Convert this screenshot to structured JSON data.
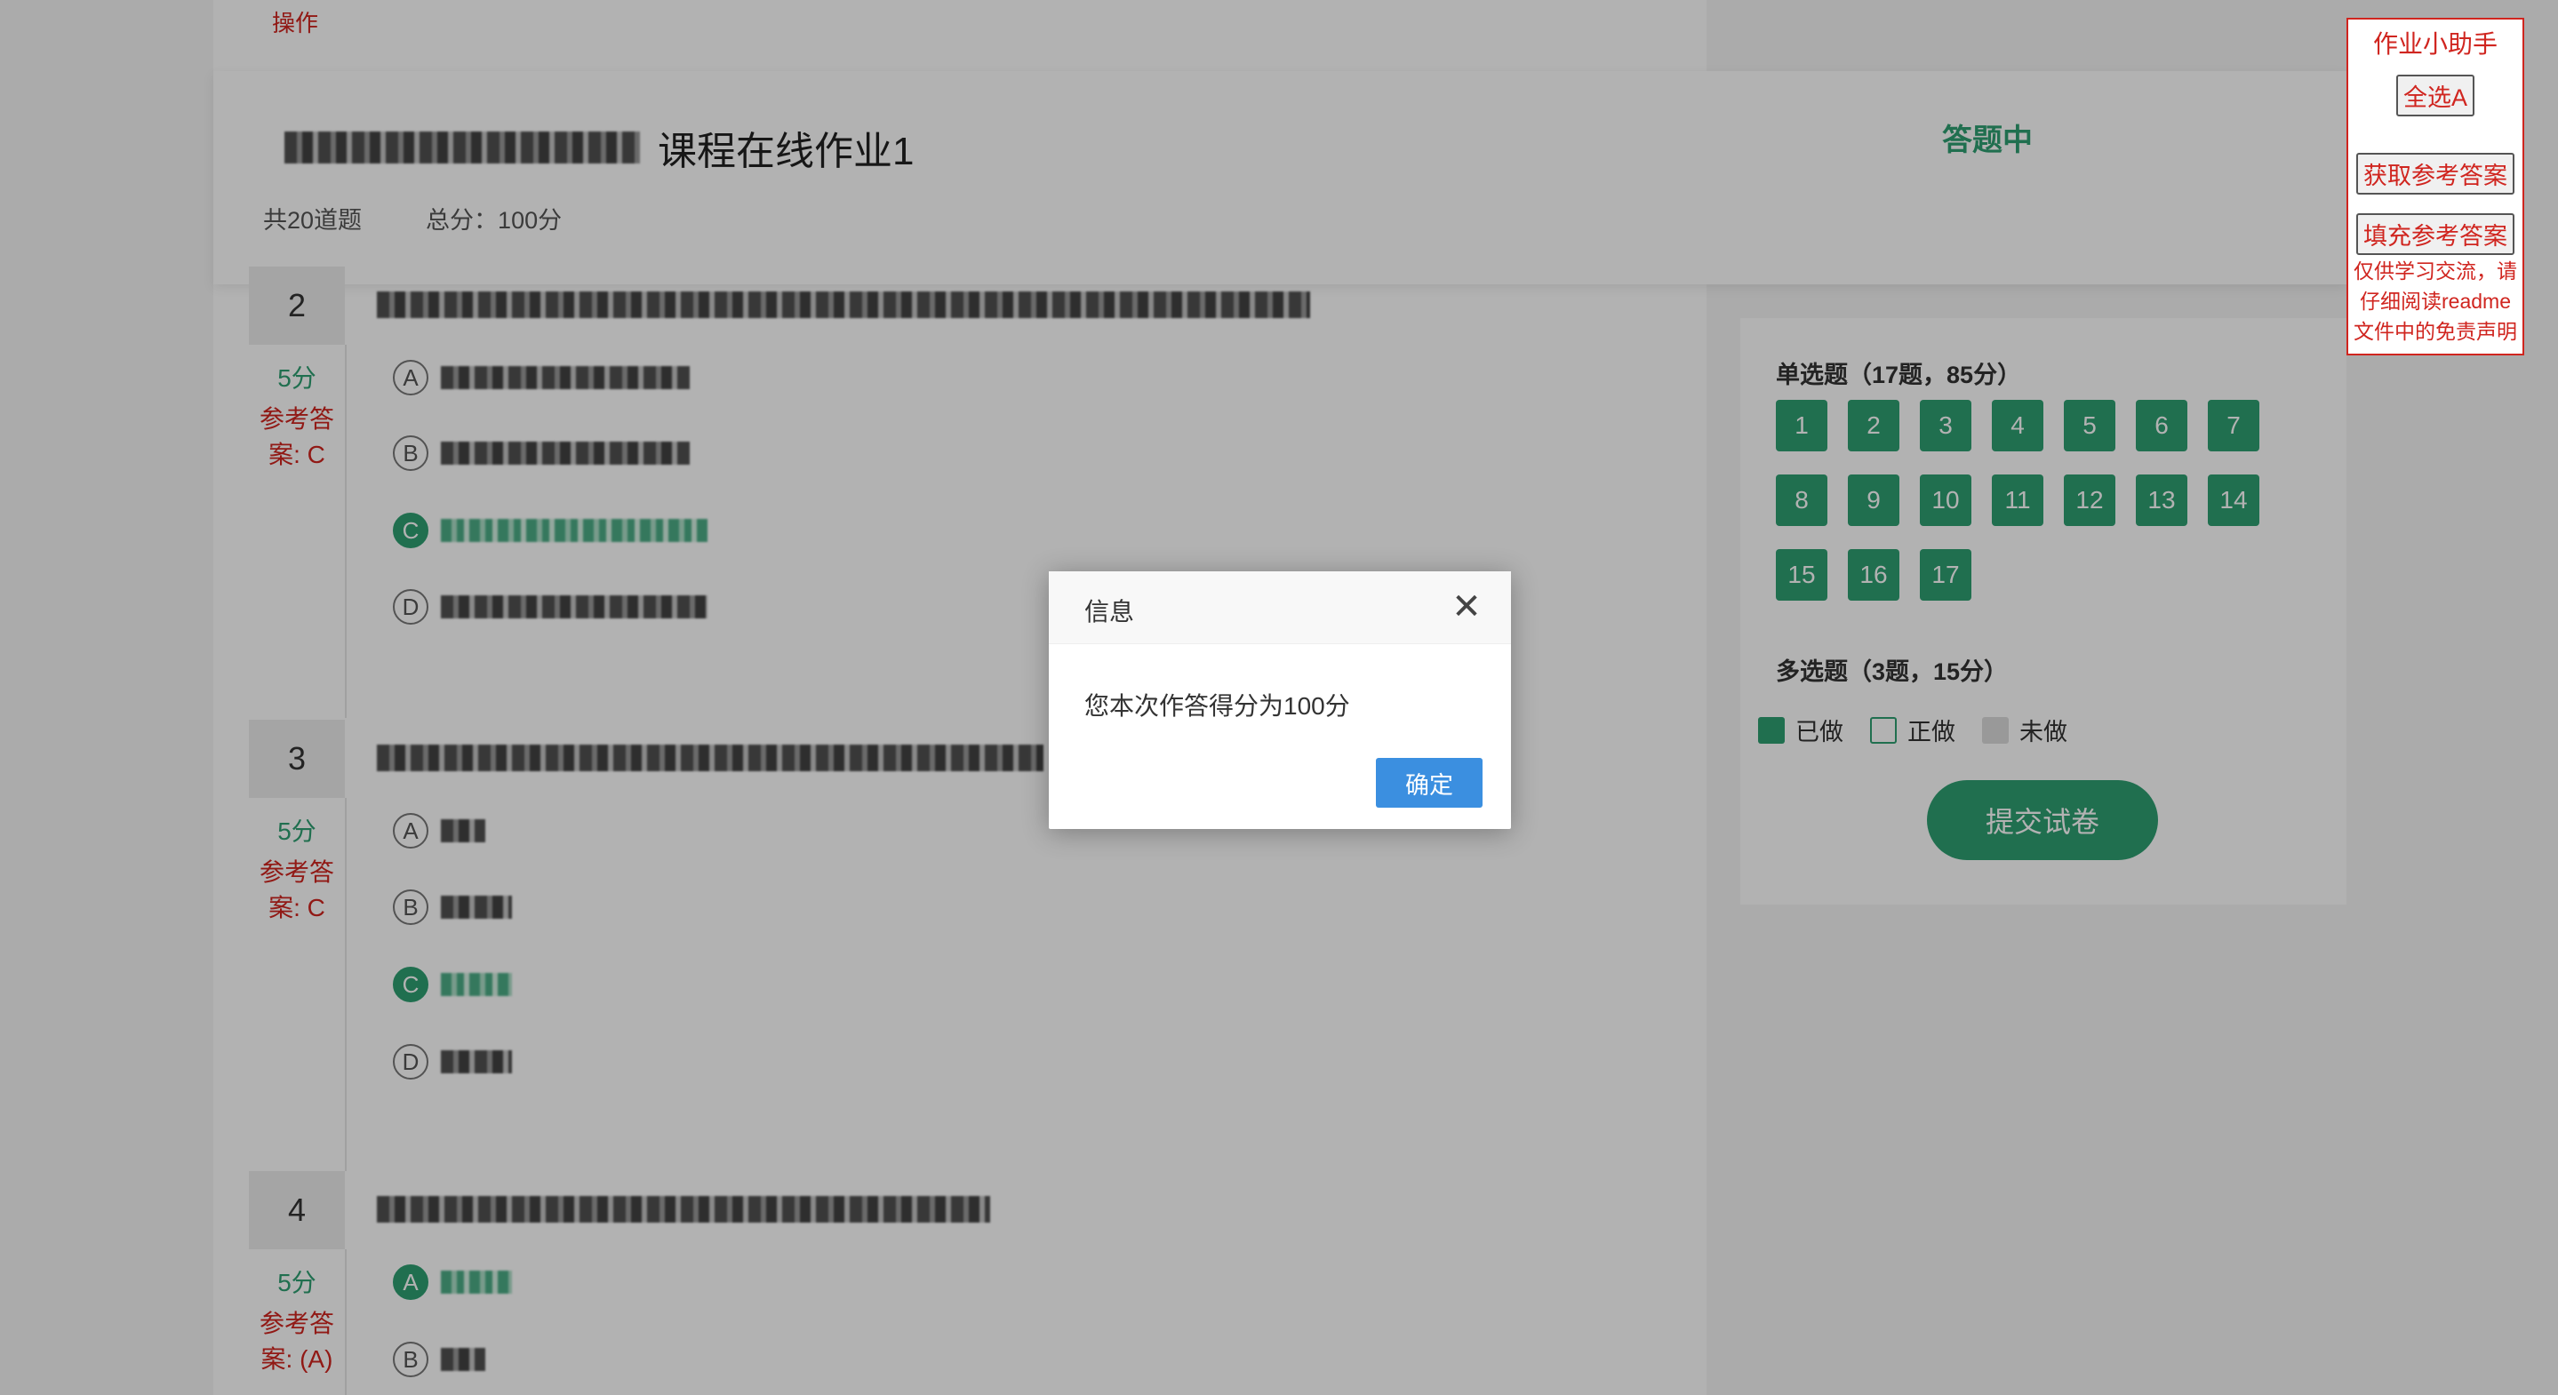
{
  "top_left": {
    "operation_label": "操作"
  },
  "header": {
    "course_suffix": "课程在线作业1",
    "question_count": "共20道题",
    "total_score": "总分：100分",
    "status": "答题中"
  },
  "questions": [
    {
      "number": "2",
      "score": "5分",
      "reference_answer": "参考答案: C",
      "options": [
        {
          "letter": "A",
          "selected": false
        },
        {
          "letter": "B",
          "selected": false
        },
        {
          "letter": "C",
          "selected": true
        },
        {
          "letter": "D",
          "selected": false
        }
      ]
    },
    {
      "number": "3",
      "score": "5分",
      "reference_answer": "参考答案: C",
      "options": [
        {
          "letter": "A",
          "selected": false
        },
        {
          "letter": "B",
          "selected": false
        },
        {
          "letter": "C",
          "selected": true
        },
        {
          "letter": "D",
          "selected": false
        }
      ]
    },
    {
      "number": "4",
      "score": "5分",
      "reference_answer": "参考答案: (A)",
      "options": [
        {
          "letter": "A",
          "selected": true
        },
        {
          "letter": "B",
          "selected": false
        }
      ]
    }
  ],
  "answer_card": {
    "single_choice_title": "单选题（17题，85分）",
    "single_choice_numbers": [
      "1",
      "2",
      "3",
      "4",
      "5",
      "6",
      "7",
      "8",
      "9",
      "10",
      "11",
      "12",
      "13",
      "14",
      "15",
      "16",
      "17"
    ],
    "multi_choice_title": "多选题（3题，15分）",
    "legend": {
      "done": "已做",
      "doing": "正做",
      "todo": "未做"
    },
    "submit_label": "提交试卷"
  },
  "helper": {
    "title": "作业小助手",
    "select_all_a": "全选A",
    "get_answers": "获取参考答案",
    "fill_answers": "填充参考答案",
    "disclaimer": "仅供学习交流，请仔细阅读readme文件中的免责声明"
  },
  "dialog": {
    "title": "信息",
    "message": "您本次作答得分为100分",
    "ok_label": "确定",
    "close_icon": "close-icon"
  },
  "colors": {
    "accent_green": "#2e9f72",
    "reference_red": "#d0251f",
    "ok_blue": "#3b8fe0"
  }
}
